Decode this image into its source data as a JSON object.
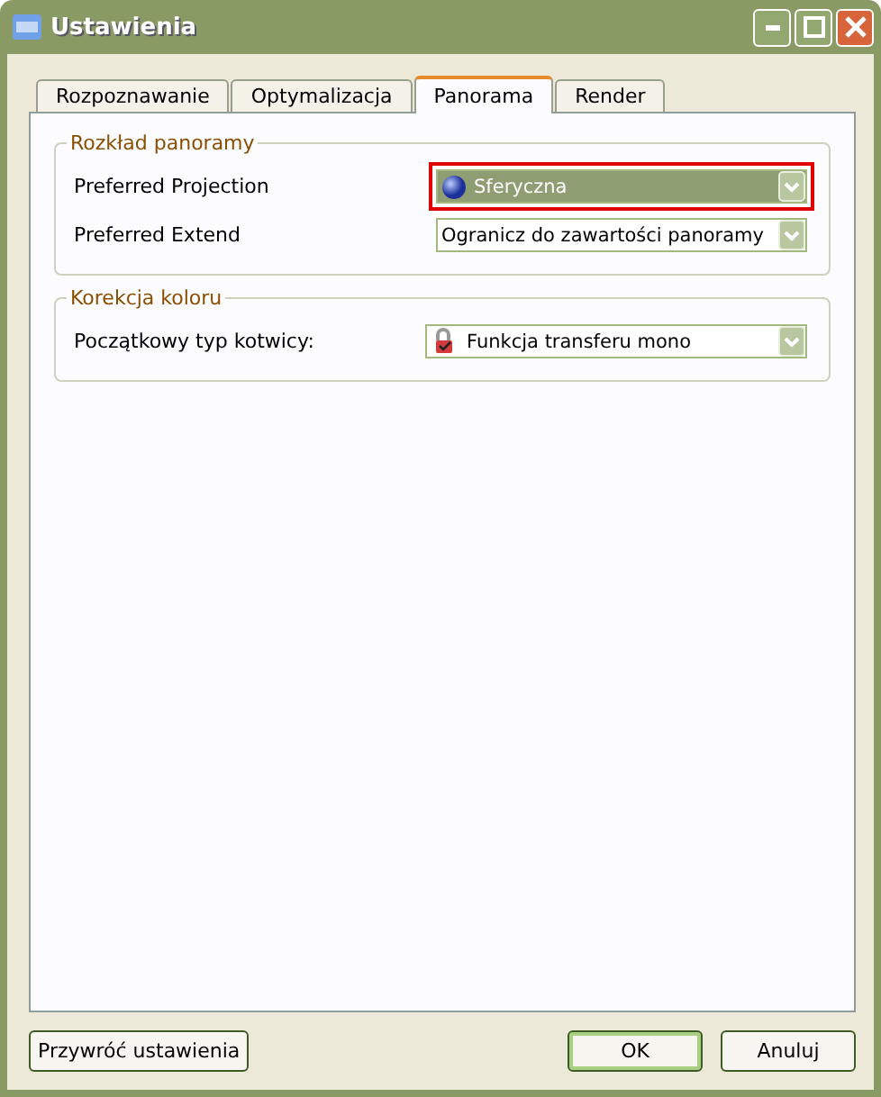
{
  "window": {
    "title": "Ustawienia"
  },
  "tabs": [
    {
      "label": "Rozpoznawanie",
      "selected": false
    },
    {
      "label": "Optymalizacja",
      "selected": false
    },
    {
      "label": "Panorama",
      "selected": true
    },
    {
      "label": "Render",
      "selected": false
    }
  ],
  "groups": [
    {
      "title": "Rozkład panoramy",
      "rows": [
        {
          "label": "Preferred Projection",
          "value": "Sferyczna",
          "kind": "globe",
          "focused": true,
          "highlighted": true,
          "wide": false
        },
        {
          "label": "Preferred Extend",
          "value": "Ogranicz do zawartości panoramy",
          "kind": "plain",
          "focused": false,
          "highlighted": false,
          "wide": false
        }
      ]
    },
    {
      "title": "Korekcja koloru",
      "rows": [
        {
          "label": "Początkowy typ kotwicy:",
          "value": "Funkcja transferu mono",
          "kind": "lock",
          "focused": false,
          "highlighted": false,
          "wide": true
        }
      ]
    }
  ],
  "buttons": [
    {
      "label": "Przywróć ustawienia",
      "default": false
    },
    {
      "label": "OK",
      "default": true
    },
    {
      "label": "Anuluj",
      "default": false
    }
  ]
}
